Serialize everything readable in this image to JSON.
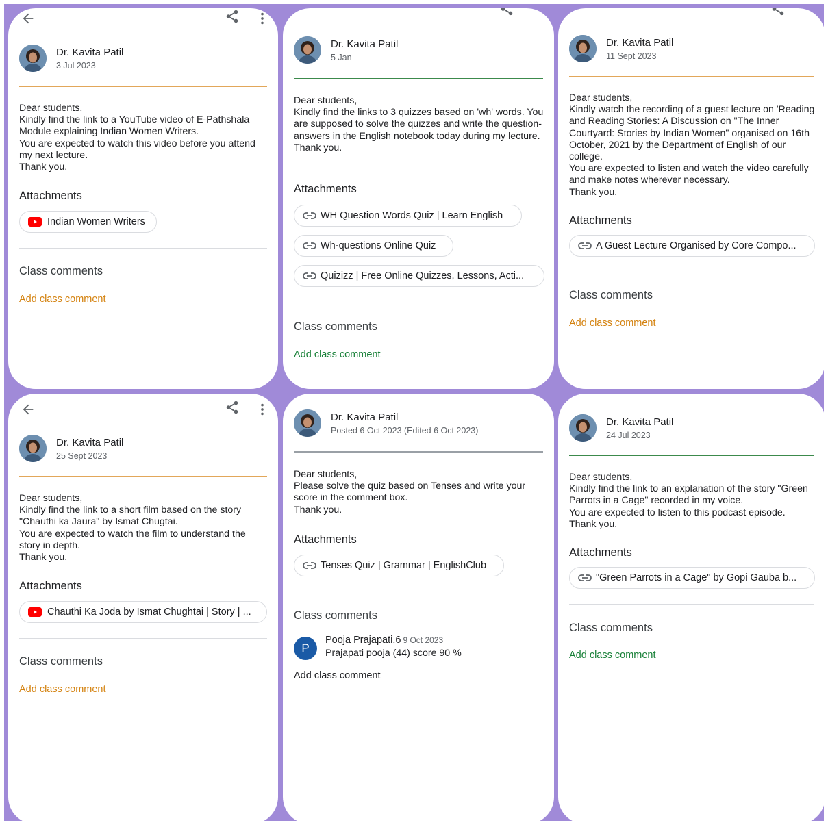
{
  "cards": [
    {
      "author": "Dr. Kavita Patil",
      "date": "3 Jul 2023",
      "body": [
        "Dear students,",
        "Kindly find the link to a YouTube video of E-Pathshala Module explaining Indian Women Writers.",
        "You are expected to watch this video before you attend my next lecture.",
        "Thank you."
      ],
      "attachments_heading": "Attachments",
      "attachments": [
        "Indian Women Writers"
      ],
      "comments_heading": "Class comments",
      "add_comment": "Add class comment"
    },
    {
      "author": "Dr. Kavita Patil",
      "date": "5 Jan",
      "body": [
        "Dear students,",
        "Kindly find the links to 3 quizzes based on 'wh' words. You are supposed to solve the quizzes and write the question-answers in the English notebook today during my lecture.",
        "Thank you."
      ],
      "attachments_heading": "Attachments",
      "attachments": [
        "WH Question Words Quiz | Learn English",
        "Wh-questions Online Quiz",
        "Quizizz | Free Online Quizzes, Lessons, Acti..."
      ],
      "comments_heading": "Class comments",
      "add_comment": "Add class comment"
    },
    {
      "author": "Dr. Kavita Patil",
      "date": "11 Sept 2023",
      "body": [
        "Dear students,",
        "Kindly watch the recording of a guest lecture on 'Reading and Reading Stories: A Discussion on \"The Inner Courtyard: Stories by Indian Women\" organised on 16th October, 2021 by the Department of English of our college.",
        "You are expected to listen and watch the video carefully and make notes wherever necessary.",
        "Thank you."
      ],
      "attachments_heading": "Attachments",
      "attachments": [
        "A Guest Lecture Organised by Core Compo..."
      ],
      "comments_heading": "Class comments",
      "add_comment": "Add class comment"
    },
    {
      "author": "Dr. Kavita Patil",
      "date": "25 Sept 2023",
      "body": [
        "Dear students,",
        "Kindly find the link to a short film based on the story \"Chauthi ka Jaura\" by Ismat Chugtai.",
        "You are expected to watch the film to understand the story in depth.",
        "Thank you."
      ],
      "attachments_heading": "Attachments",
      "attachments": [
        "Chauthi Ka Joda by Ismat Chughtai | Story | ..."
      ],
      "comments_heading": "Class comments",
      "add_comment": "Add class comment"
    },
    {
      "author": "Dr. Kavita Patil",
      "date": "Posted 6 Oct 2023 (Edited 6 Oct 2023)",
      "body": [
        "Dear students,",
        "Please solve the quiz based on Tenses and write your score in the comment box.",
        "Thank you."
      ],
      "attachments_heading": "Attachments",
      "attachments": [
        "Tenses Quiz | Grammar | EnglishClub"
      ],
      "comments_heading": "Class comments",
      "comment": {
        "initial": "P",
        "name": "Pooja Prajapati.6",
        "date": "9 Oct 2023",
        "text": "Prajapati pooja (44)  score 90 %"
      },
      "add_comment": "Add class comment"
    },
    {
      "author": "Dr. Kavita Patil",
      "date": "24 Jul 2023",
      "body": [
        "Dear students,",
        "Kindly find the link to an explanation of the story \"Green Parrots in a Cage\" recorded in my voice.",
        "You are expected to listen to this podcast episode.",
        "Thank you."
      ],
      "attachments_heading": "Attachments",
      "attachments": [
        "\"Green Parrots in a Cage\" by Gopi Gauba b..."
      ],
      "comments_heading": "Class comments",
      "add_comment": "Add class comment"
    }
  ],
  "colors": {
    "background": "#a08ad8",
    "orange_accent": "#d4820f",
    "green_accent": "#188038",
    "youtube_red": "#ff0000",
    "commenter_avatar": "#1a5aa6"
  },
  "icons": {
    "back": "arrow-left-icon",
    "share": "share-icon",
    "more": "more-vertical-icon",
    "youtube": "youtube-icon",
    "link": "link-icon"
  }
}
